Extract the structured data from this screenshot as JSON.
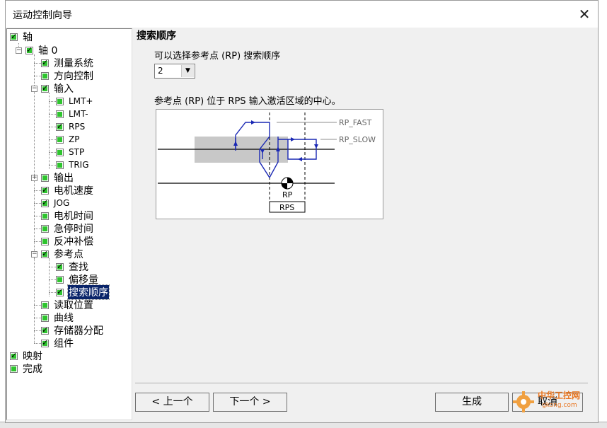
{
  "dialog": {
    "title": "运动控制向导"
  },
  "tree": {
    "axis": "轴",
    "axis0": "轴 0",
    "measure": "测量系统",
    "direction": "方向控制",
    "input": "输入",
    "lmt_plus": "LMT+",
    "lmt_minus": "LMT-",
    "rps": "RPS",
    "zp": "ZP",
    "stp": "STP",
    "trig": "TRIG",
    "output": "输出",
    "motor_speed": "电机速度",
    "jog": "JOG",
    "motor_time": "电机时间",
    "estop_time": "急停时间",
    "backlash": "反冲补偿",
    "refpoint": "参考点",
    "find": "查找",
    "offset": "偏移量",
    "search_order": "搜索顺序",
    "read_pos": "读取位置",
    "curve": "曲线",
    "memory": "存储器分配",
    "component": "组件",
    "mapping": "映射",
    "finish": "完成"
  },
  "content": {
    "section_title": "搜索顺序",
    "select_label": "可以选择参考点 (RP) 搜索顺序",
    "select_value": "2",
    "description": "参考点 (RP) 位于 RPS 输入激活区域的中心。",
    "diagram": {
      "rp_fast": "RP_FAST",
      "rp_slow": "RP_SLOW",
      "rp": "RP",
      "rps": "RPS"
    }
  },
  "buttons": {
    "prev": "< 上一个",
    "next": "下一个 >",
    "generate": "生成",
    "cancel": "取消"
  },
  "watermark": {
    "text": "中华工控网",
    "url": "gkong.com"
  },
  "colors": {
    "checked_green": "#2ec42e",
    "selection": "#0a246a",
    "arrow_blue": "#1a28b4",
    "active_zone": "#c8c8c8"
  }
}
